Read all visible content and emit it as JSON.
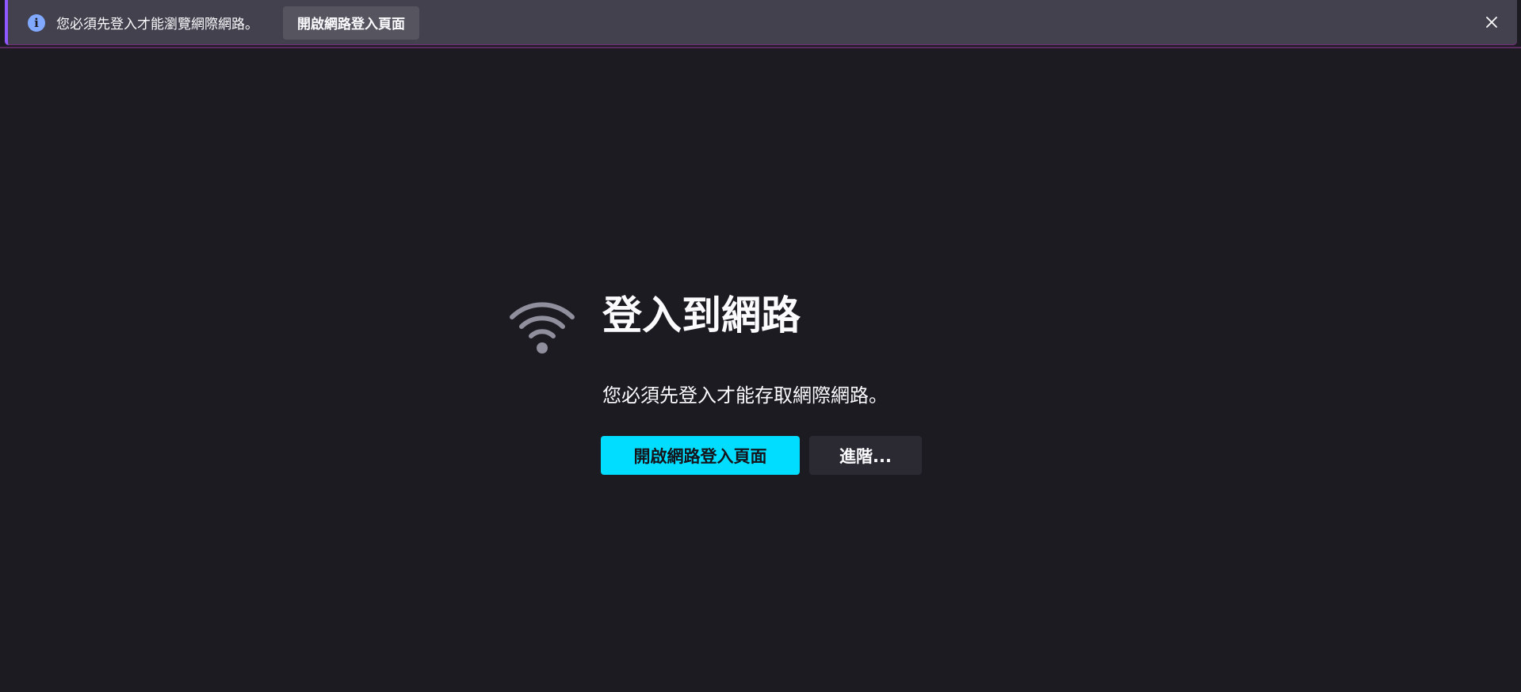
{
  "notification": {
    "message": "您必須先登入才能瀏覽網際網路。",
    "button_label": "開啟網路登入頁面",
    "info_icon": "info-icon",
    "close_icon": "close-icon"
  },
  "main": {
    "icon": "wifi-icon",
    "title": "登入到網路",
    "description": "您必須先登入才能存取網際網路。",
    "primary_button_label": "開啟網路登入頁面",
    "secondary_button_label": "進階..."
  },
  "colors": {
    "background": "#1c1b22",
    "notification_bar": "#42414d",
    "primary_button": "#00ddff",
    "secondary_button": "#2b2a33",
    "info_icon": "#80a9ff",
    "wifi_icon": "#8f8f9d"
  }
}
